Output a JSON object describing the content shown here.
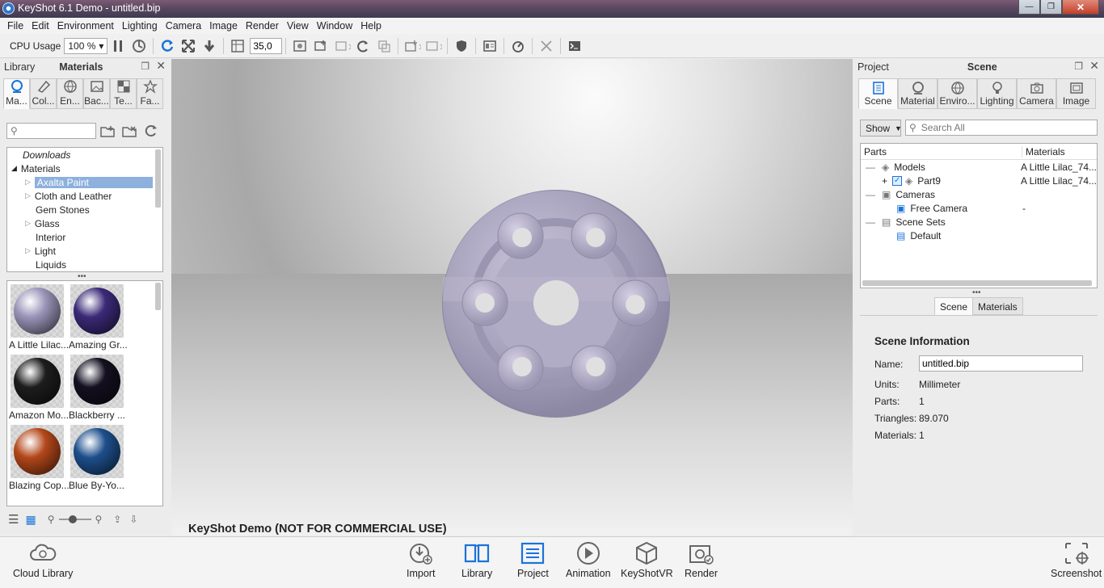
{
  "window": {
    "title": "KeyShot 6.1 Demo  -  untitled.bip",
    "buttons": {
      "minimize": "—",
      "maximize": "❐",
      "close": "✕"
    }
  },
  "menu": [
    "File",
    "Edit",
    "Environment",
    "Lighting",
    "Camera",
    "Image",
    "Render",
    "View",
    "Window",
    "Help"
  ],
  "toolbar": {
    "cpu_label": "CPU Usage",
    "cpu_value": "100 %",
    "fov_value": "35,0"
  },
  "library": {
    "title": "Library",
    "active": "Materials",
    "tabs": [
      "Ma...",
      "Col...",
      "En...",
      "Bac...",
      "Te...",
      "Fa..."
    ],
    "search_placeholder": "",
    "tree": [
      {
        "label": "Downloads",
        "italic": true,
        "indent": 0
      },
      {
        "label": "Materials",
        "expanded": true,
        "indent": 0
      },
      {
        "label": "Axalta Paint",
        "selected": true,
        "indent": 1
      },
      {
        "label": "Cloth and Leather",
        "indent": 1
      },
      {
        "label": "Gem Stones",
        "indent": 1,
        "leaf": true
      },
      {
        "label": "Glass",
        "indent": 1
      },
      {
        "label": "Interior",
        "indent": 1,
        "leaf": true
      },
      {
        "label": "Light",
        "indent": 1
      },
      {
        "label": "Liquids",
        "indent": 1,
        "leaf": true
      }
    ],
    "thumbs": [
      {
        "label": "A Little Lilac...",
        "color": "#9a94b8"
      },
      {
        "label": "Amazing Gr...",
        "color": "#3b2a78"
      },
      {
        "label": "Amazon Mo...",
        "color": "#1d1d1d"
      },
      {
        "label": "Blackberry ...",
        "color": "#141020"
      },
      {
        "label": "Blazing Cop...",
        "color": "#b3471a"
      },
      {
        "label": "Blue By-Yo...",
        "color": "#1d4f8c"
      }
    ]
  },
  "viewport": {
    "watermark": "KeyShot Demo (NOT FOR COMMERCIAL USE)",
    "part_color": "#a8a3bd"
  },
  "project": {
    "title": "Project",
    "active": "Scene",
    "tabs": [
      "Scene",
      "Material",
      "Enviro...",
      "Lighting",
      "Camera",
      "Image"
    ],
    "show_label": "Show",
    "search_placeholder": "Search All",
    "columns": [
      "Parts",
      "Materials"
    ],
    "tree": [
      {
        "label": "Models",
        "material": "A Little Lilac_74..."
      },
      {
        "label": "Part9",
        "material": "A Little Lilac_74..."
      },
      {
        "label": "Cameras",
        "material": ""
      },
      {
        "label": "Free Camera",
        "material": "-"
      },
      {
        "label": "Scene Sets",
        "material": ""
      },
      {
        "label": "Default",
        "material": ""
      }
    ],
    "subtabs": [
      "Scene",
      "Materials"
    ],
    "info": {
      "heading": "Scene Information",
      "name_label": "Name:",
      "name_value": "untitled.bip",
      "units_label": "Units:",
      "units_value": "Millimeter",
      "parts_label": "Parts:",
      "parts_value": "1",
      "triangles_label": "Triangles:",
      "triangles_value": "89.070",
      "materials_label": "Materials:",
      "materials_value": "1"
    }
  },
  "bottombar": [
    "Cloud Library",
    "Import",
    "Library",
    "Project",
    "Animation",
    "KeyShotVR",
    "Render",
    "Screenshot"
  ]
}
